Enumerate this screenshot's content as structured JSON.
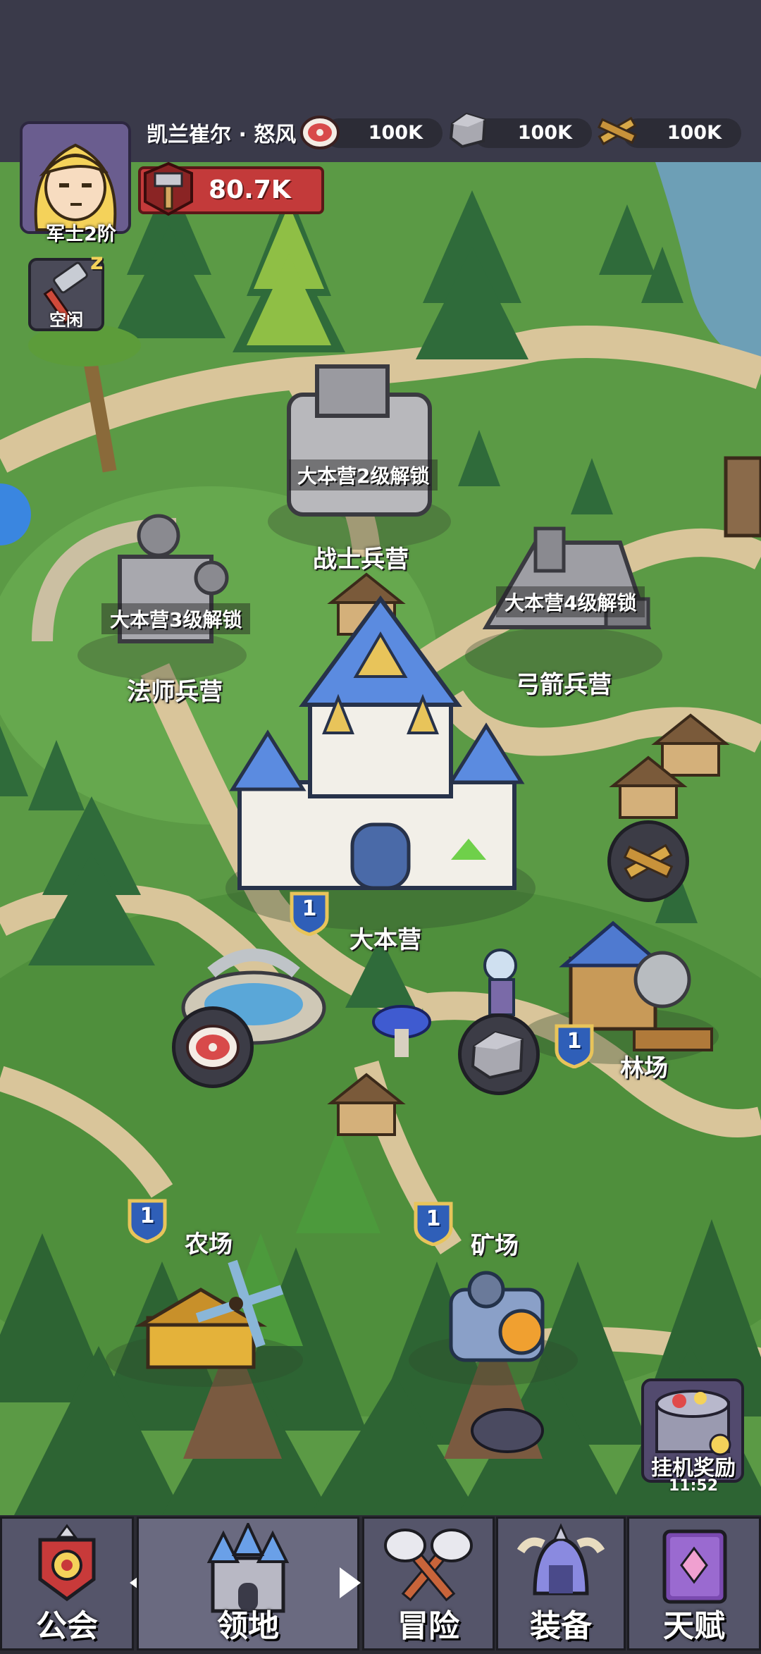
{
  "player": {
    "name": "凯兰崔尔 · 怒风",
    "rank": "军士2阶",
    "power": "80.7K",
    "status": "空闲"
  },
  "resources": [
    {
      "name": "meat",
      "icon": "meat-icon",
      "value": "100K"
    },
    {
      "name": "stone",
      "icon": "stone-icon",
      "value": "100K"
    },
    {
      "name": "wood",
      "icon": "wood-icon",
      "value": "100K"
    }
  ],
  "buildings": {
    "warrior_barracks": {
      "label": "战士兵营",
      "lock": "大本营2级解锁"
    },
    "mage_barracks": {
      "label": "法师兵营",
      "lock": "大本营3级解锁"
    },
    "archer_barracks": {
      "label": "弓箭兵营",
      "lock": "大本营4级解锁"
    },
    "headquarters": {
      "label": "大本营",
      "level": "1"
    },
    "lumber_mill": {
      "label": "林场",
      "level": "1"
    },
    "farm": {
      "label": "农场",
      "level": "1"
    },
    "quarry": {
      "label": "矿场",
      "level": "1"
    },
    "fountain": {
      "level": ""
    }
  },
  "idle_reward": {
    "label": "挂机奖励",
    "timer": "11:52"
  },
  "nav": {
    "tabs": [
      {
        "label": "公会",
        "icon": "guild-banner-icon"
      },
      {
        "label": "领地",
        "icon": "castle-icon"
      },
      {
        "label": "冒险",
        "icon": "crossed-axes-icon"
      },
      {
        "label": "装备",
        "icon": "helmet-icon"
      },
      {
        "label": "天赋",
        "icon": "talent-book-icon"
      }
    ]
  },
  "colors": {
    "grass": "#5b9a45",
    "path": "#d9c59a",
    "topbar": "#3a3a4a",
    "nav": "#2b2b33",
    "power_red": "#c33a3a",
    "level_badge": "#2f5fb8"
  }
}
